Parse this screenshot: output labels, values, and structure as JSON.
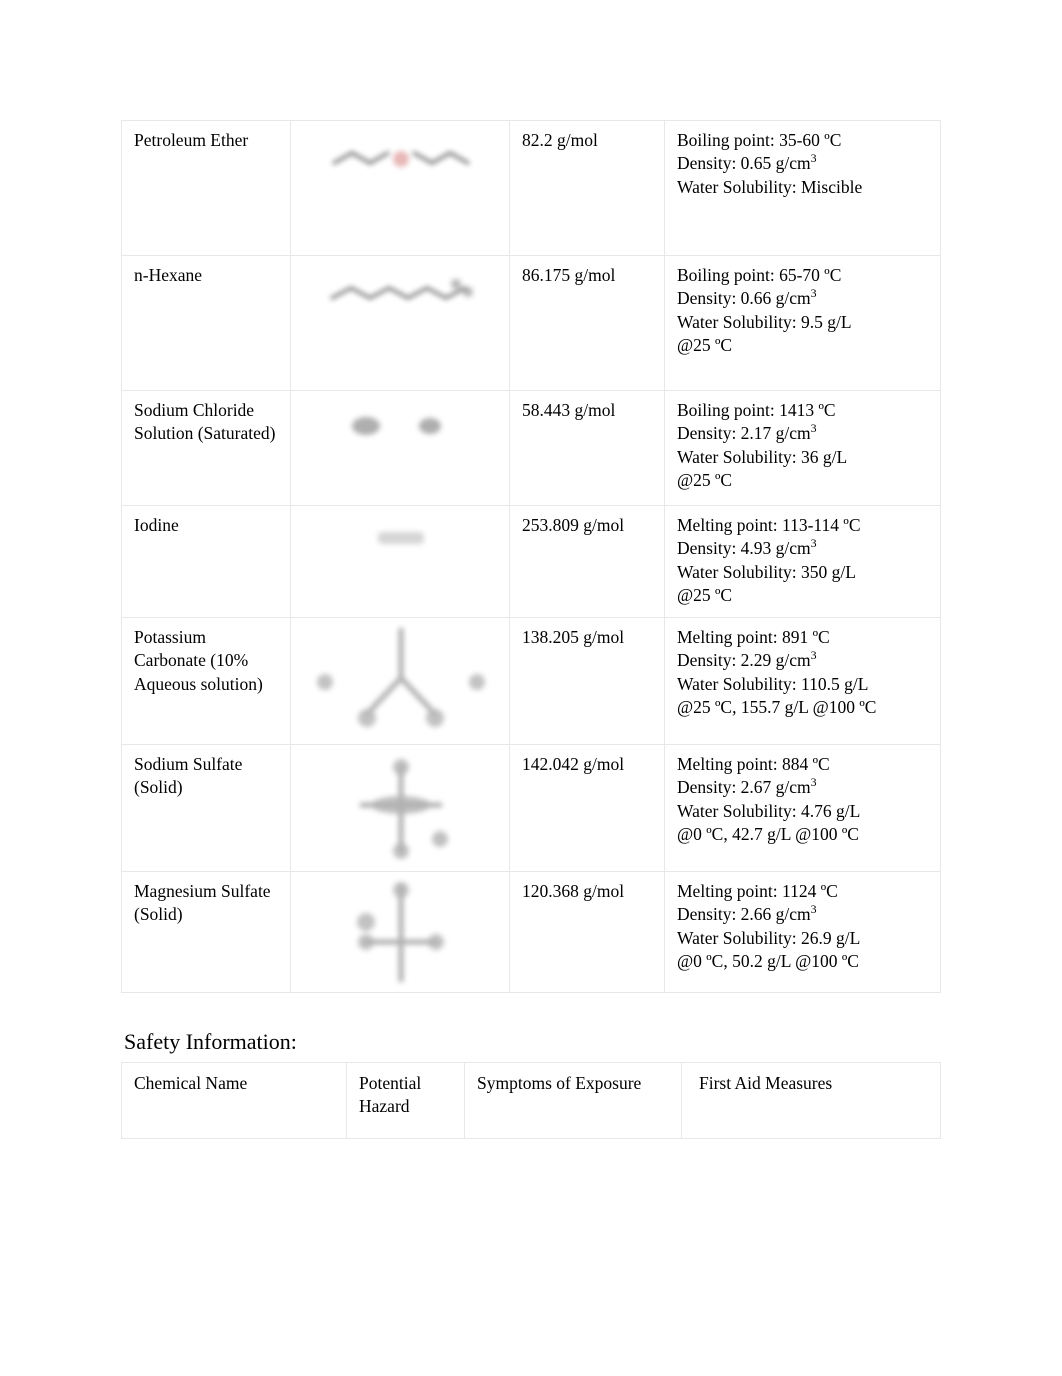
{
  "document": {
    "background_color": "#ffffff",
    "text_color": "#000000",
    "border_color": "#e8e8e8"
  },
  "chemical_table": {
    "rows": [
      {
        "name": "Petroleum Ether",
        "structure_icon": "petroleum-ether-skeletal-structure",
        "molar_mass": "82.2 g/mol",
        "properties": [
          "Boiling point: 35-60 ºC",
          "Density: 0.65 g/cm3",
          "Water Solubility: Miscible"
        ],
        "property_lines": {
          "line1": "Boiling point: 35-60 ºC",
          "line2_prefix": "Density: 0.65 g/cm",
          "line2_sup": "3",
          "line3": "Water Solubility: Miscible",
          "line4": ""
        }
      },
      {
        "name": "n-Hexane",
        "structure_icon": "n-hexane-skeletal-structure",
        "molar_mass": "86.175 g/mol",
        "properties": [
          "Boiling point: 65-70 ºC",
          "Density: 0.66 g/cm3",
          "Water Solubility: 9.5 g/L",
          "@25 ºC"
        ],
        "property_lines": {
          "line1": "Boiling point: 65-70 ºC",
          "line2_prefix": "Density: 0.66 g/cm",
          "line2_sup": "3",
          "line3": "Water Solubility: 9.5 g/L",
          "line4": "@25 ºC"
        }
      },
      {
        "name": "Sodium Chloride Solution (Saturated)",
        "structure_icon": "sodium-chloride-ion-pair-structure",
        "molar_mass": "58.443 g/mol",
        "properties": [
          "Boiling point: 1413 ºC",
          "Density: 2.17 g/cm3",
          "Water Solubility: 36 g/L",
          "@25 ºC"
        ],
        "property_lines": {
          "line1": "Boiling point: 1413 ºC",
          "line2_prefix": "Density: 2.17 g/cm",
          "line2_sup": "3",
          "line3": "Water Solubility: 36 g/L",
          "line4": "@25 ºC"
        }
      },
      {
        "name": "Iodine",
        "structure_icon": "iodine-diatomic-structure",
        "molar_mass": "253.809 g/mol",
        "properties": [
          "Melting point: 113-114 ºC",
          "Density: 4.93 g/cm3",
          "Water Solubility: 350 g/L",
          "@25 ºC"
        ],
        "property_lines": {
          "line1": "Melting point: 113-114 ºC",
          "line2_prefix": "Density: 4.93 g/cm",
          "line2_sup": "3",
          "line3": "Water Solubility: 350 g/L",
          "line4": "@25 ºC"
        }
      },
      {
        "name": "Potassium Carbonate (10% Aqueous solution)",
        "structure_icon": "potassium-carbonate-structure",
        "molar_mass": "138.205 g/mol",
        "properties": [
          "Melting point: 891 ºC",
          "Density: 2.29 g/cm3",
          "Water Solubility: 110.5 g/L",
          "@25 ºC, 155.7 g/L @100 ºC"
        ],
        "property_lines": {
          "line1": "Melting point: 891 ºC",
          "line2_prefix": "Density: 2.29 g/cm",
          "line2_sup": "3",
          "line3": "Water Solubility: 110.5 g/L",
          "line4": "@25 ºC, 155.7 g/L @100 ºC"
        }
      },
      {
        "name": "Sodium Sulfate (Solid)",
        "structure_icon": "sodium-sulfate-structure",
        "molar_mass": "142.042 g/mol",
        "properties": [
          "Melting point: 884 ºC",
          "Density: 2.67 g/cm3",
          "Water Solubility: 4.76 g/L",
          "@0 ºC, 42.7 g/L @100 ºC"
        ],
        "property_lines": {
          "line1": "Melting point: 884 ºC",
          "line2_prefix": "Density: 2.67 g/cm",
          "line2_sup": "3",
          "line3": "Water Solubility: 4.76 g/L",
          "line4": "@0 ºC, 42.7 g/L @100 ºC"
        }
      },
      {
        "name": "Magnesium Sulfate (Solid)",
        "structure_icon": "magnesium-sulfate-structure",
        "molar_mass": "120.368 g/mol",
        "properties": [
          "Melting point: 1124 ºC",
          "Density: 2.66 g/cm3",
          "Water Solubility: 26.9 g/L",
          "@0 ºC, 50.2 g/L @100 ºC"
        ],
        "property_lines": {
          "line1": "Melting point: 1124 ºC",
          "line2_prefix": "Density: 2.66 g/cm",
          "line2_sup": "3",
          "line3": "Water Solubility: 26.9 g/L",
          "line4": "@0 ºC, 50.2 g/L @100 ºC"
        }
      }
    ]
  },
  "safety_section": {
    "heading": "Safety Information:",
    "headers": [
      "Chemical Name",
      "Potential Hazard",
      "Symptoms of Exposure",
      "First Aid Measures"
    ],
    "header_cells": {
      "chemical_name": "Chemical Name",
      "potential_hazard": "Potential Hazard",
      "symptoms_of_exposure": "Symptoms of Exposure",
      "first_aid_measures": "First Aid Measures"
    },
    "rows": []
  }
}
